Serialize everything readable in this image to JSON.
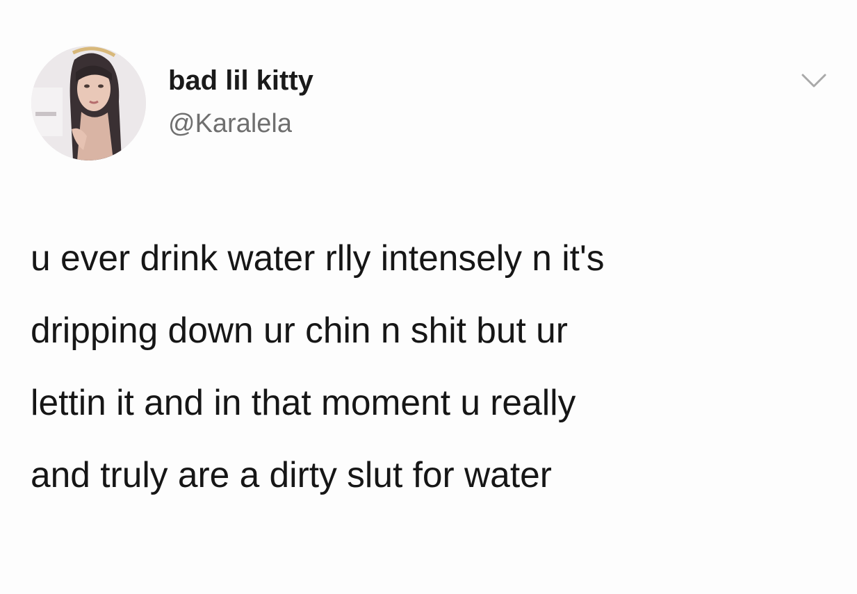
{
  "tweet": {
    "author": {
      "display_name": "bad lil kitty",
      "handle": "@Karalela",
      "avatar_icon": "profile-photo"
    },
    "menu_icon": "chevron-down-icon",
    "text_lines": [
      "u ever drink water rlly intensely n it's",
      "dripping down ur chin n shit but ur",
      "lettin it and in that moment u really",
      "and truly are a dirty slut for water"
    ]
  }
}
